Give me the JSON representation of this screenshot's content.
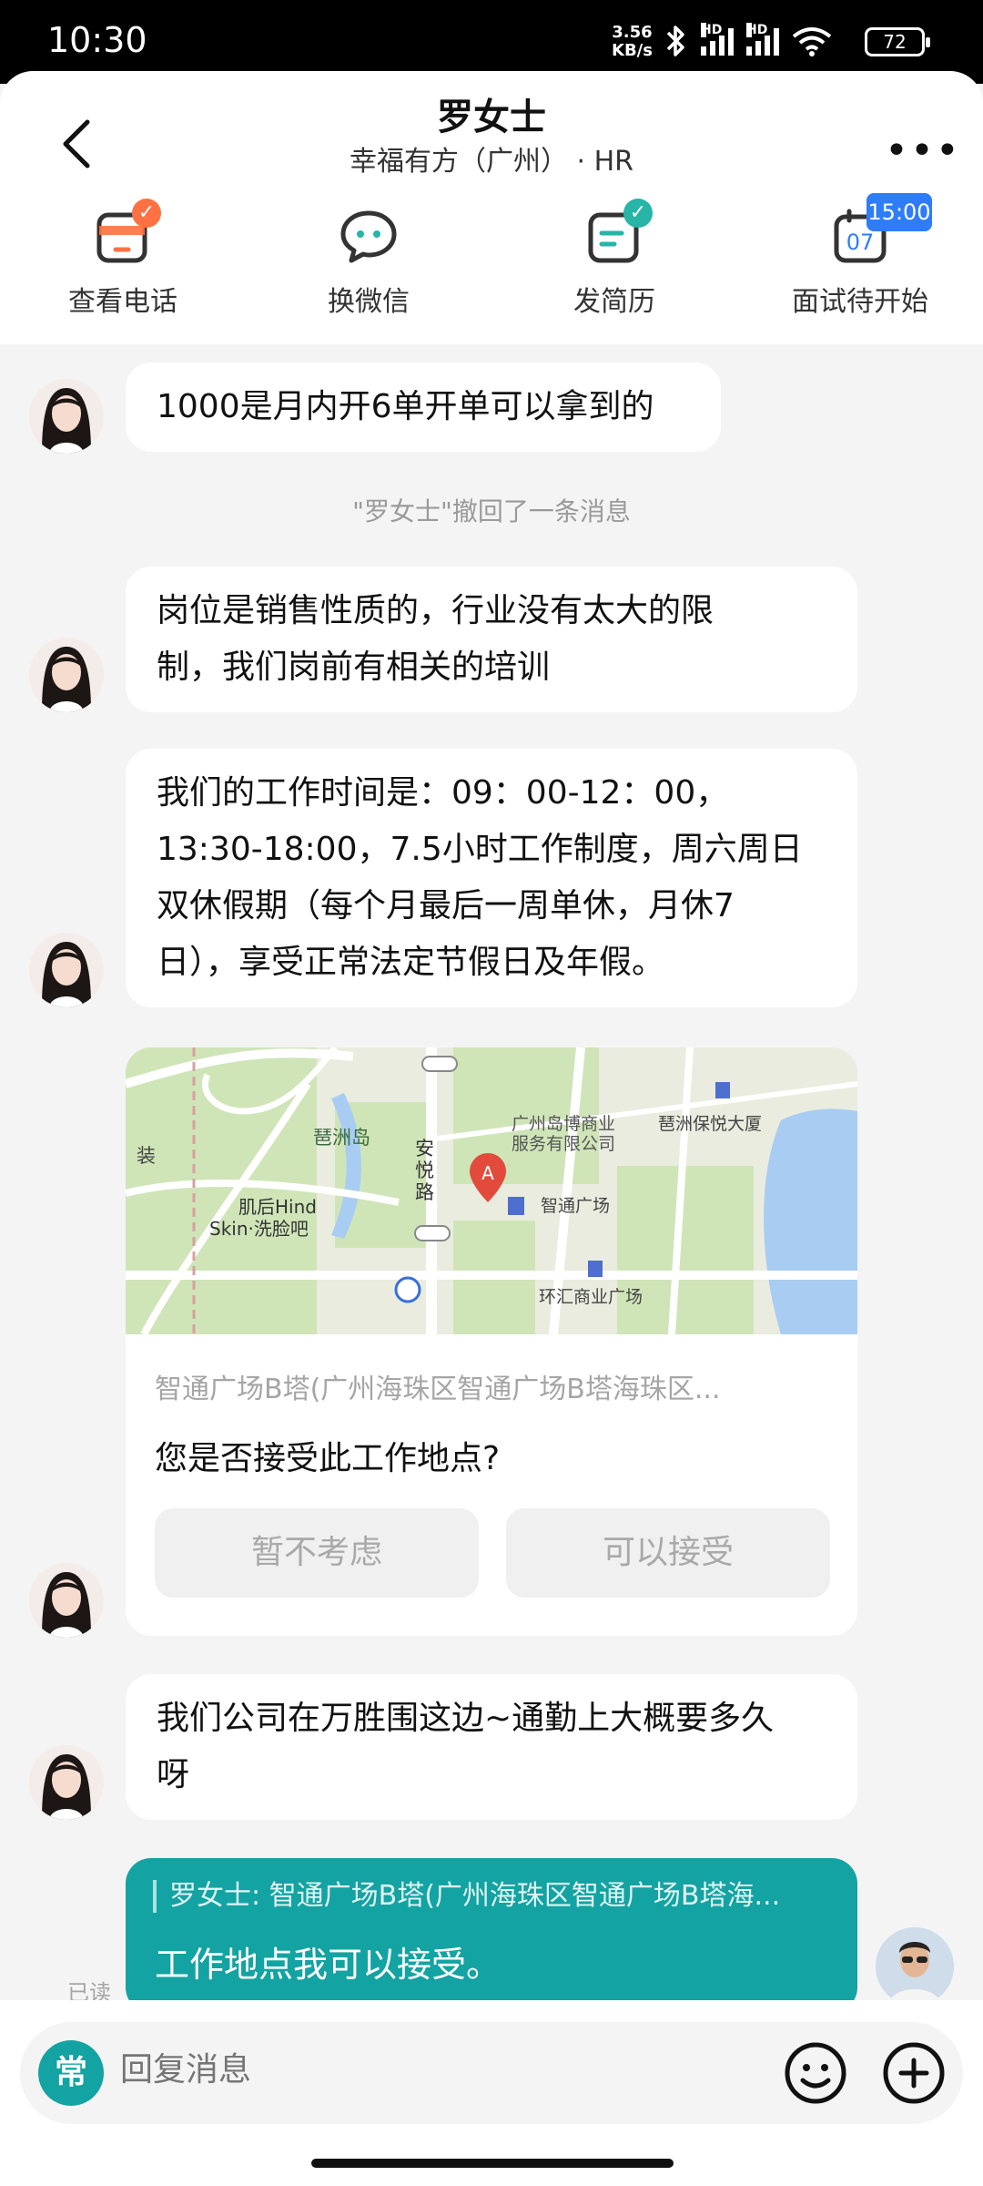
{
  "status_bar": {
    "time": "10:30",
    "net_speed_value": "3.56",
    "net_speed_unit": "KB/s",
    "hd_1": "HD",
    "hd_2": "HD",
    "battery": "72"
  },
  "header": {
    "title": "罗女士",
    "subtitle": "幸福有方（广州） · HR",
    "actions": [
      {
        "label": "查看电话",
        "icon": "phone-card-icon"
      },
      {
        "label": "换微信",
        "icon": "wechat-icon"
      },
      {
        "label": "发简历",
        "icon": "resume-icon"
      },
      {
        "label": "面试待开始",
        "icon": "calendar-icon",
        "calendar_day": "07"
      }
    ],
    "interview_time": "15:00"
  },
  "messages": {
    "m1": "1000是月内开6单开单可以拿到的",
    "recall_notice": "\"罗女士\"撤回了一条消息",
    "m2_line1": "岗位是销售性质的，行业没有太大的限",
    "m2_line2": "制，我们岗前有相关的培训",
    "m3_line1": "我们的工作时间是：09：00-12：00，",
    "m3_line2": "13:30-18:00，7.5小时工作制度，周六周日",
    "m3_line3": "双休假期（每个月最后一周单休，月休7",
    "m3_line4": "日），享受正常法定节假日及年假。",
    "m4_line1": "我们公司在万胜围这边~通勤上大概要多久",
    "m4_line2": "呀"
  },
  "location_card": {
    "map_labels": {
      "island": "琶洲岛",
      "road_1": "安",
      "road_2": "悦",
      "road_3": "路",
      "service_1": "广州岛博商业",
      "service_2": "服务有限公司",
      "tower": "琶洲保悦大厦",
      "spa_1": "肌后Hind",
      "spa_2": "Skin·洗脸吧",
      "plaza": "智通广场",
      "mall": "环汇商业广场",
      "edge": "装",
      "marker": "A"
    },
    "address": "智通广场B塔(广州海珠区智通广场B塔海珠区...",
    "question": "您是否接受此工作地点?",
    "decline_label": "暂不考虑",
    "accept_label": "可以接受"
  },
  "my_message": {
    "quote": "罗女士: 智通广场B塔(广州海珠区智通广场B塔海...",
    "text": "工作地点我可以接受。",
    "read_status": "已读"
  },
  "input": {
    "quick_label": "常",
    "placeholder": "回复消息"
  },
  "colors": {
    "accent": "#13a3a2",
    "badge_orange": "#ff7043",
    "badge_teal": "#26b5a6",
    "badge_blue": "#2f7df6"
  }
}
